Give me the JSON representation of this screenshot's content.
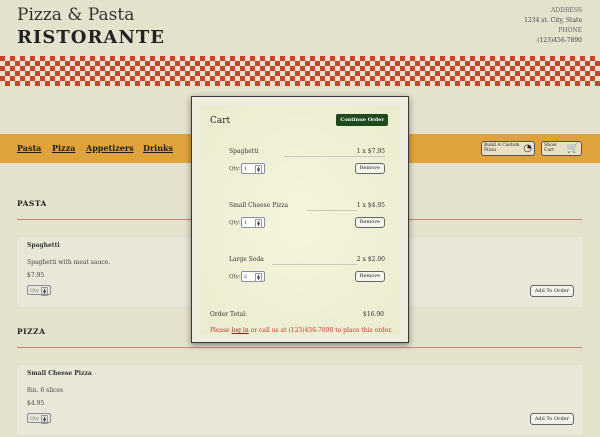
{
  "header": {
    "brand_line1": "Pizza & Pasta",
    "brand_line2": "RISTORANTE",
    "address_label": "ADDRESS",
    "address_value": "1234 st. City, State",
    "phone_label": "PHONE",
    "phone_value": "(123)456-7890"
  },
  "nav": {
    "items": [
      "Pasta",
      "Pizza",
      "Appetizers",
      "Drinks"
    ],
    "build_pizza_label": "Build A Custom Pizza",
    "show_cart_label": "Show Cart"
  },
  "sections": [
    {
      "title": "PASTA",
      "item": {
        "name": "Spaghetti",
        "desc": "Spaghetti with meat sauce.",
        "price": "$7.95",
        "qty_placeholder": "Qty",
        "add_label": "Add To Order"
      }
    },
    {
      "title": "PIZZA",
      "item": {
        "name": "Small Cheese Pizza",
        "desc": "8in. 6 slices",
        "price": "$4.95",
        "qty_placeholder": "Qty",
        "add_label": "Add To Order"
      }
    }
  ],
  "cart": {
    "title": "Cart",
    "continue_label": "Continue Order",
    "qty_label": "Qty:",
    "remove_label": "Remove",
    "items": [
      {
        "name": "Spaghetti",
        "price": "1 x $7.95",
        "qty": "1"
      },
      {
        "name": "Small Cheese Pizza",
        "price": "1 x $4.95",
        "qty": "1"
      },
      {
        "name": "Large Soda",
        "price": "2 x $2.00",
        "qty": "2"
      }
    ],
    "total_label": "Order Total:",
    "total_value": "$16.90",
    "note_prefix": "Please",
    "note_login": "log in",
    "note_suffix": "or call us at (123)456-7890 to place this order."
  },
  "colors": {
    "background": "#e4e2cc",
    "nav_bar": "#e0a33b",
    "checker_red": "#c6452b",
    "continue_button": "#1e4a1e",
    "note_red": "#c0392b"
  }
}
